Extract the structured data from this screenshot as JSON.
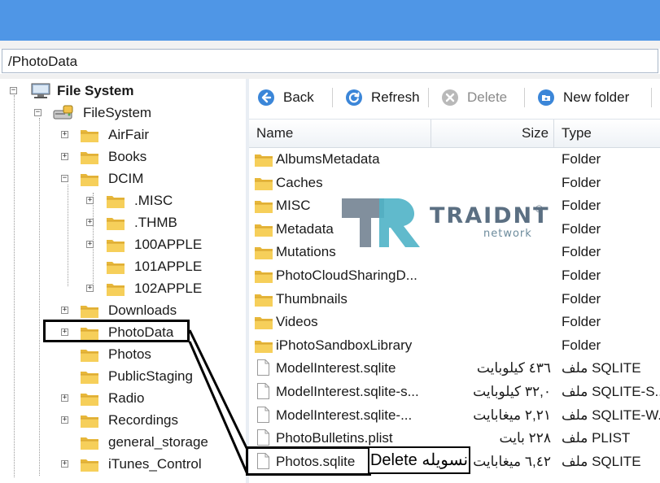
{
  "address": {
    "path": "/PhotoData"
  },
  "tree": {
    "items": [
      {
        "label": "File System",
        "bold": true
      },
      {
        "label": "FileSystem"
      },
      {
        "label": "AirFair"
      },
      {
        "label": "Books"
      },
      {
        "label": "DCIM"
      },
      {
        "label": ".MISC"
      },
      {
        "label": ".THMB"
      },
      {
        "label": "100APPLE"
      },
      {
        "label": "101APPLE"
      },
      {
        "label": "102APPLE"
      },
      {
        "label": "Downloads"
      },
      {
        "label": "PhotoData"
      },
      {
        "label": "Photos"
      },
      {
        "label": "PublicStaging"
      },
      {
        "label": "Radio"
      },
      {
        "label": "Recordings"
      },
      {
        "label": "general_storage"
      },
      {
        "label": "iTunes_Control"
      }
    ]
  },
  "toolbar": {
    "back": "Back",
    "refresh": "Refresh",
    "delete": "Delete",
    "new_folder": "New folder"
  },
  "columns": {
    "name": "Name",
    "size": "Size",
    "type": "Type"
  },
  "files": [
    {
      "name": "AlbumsMetadata",
      "size": "",
      "type": "Folder",
      "kind": "folder"
    },
    {
      "name": "Caches",
      "size": "",
      "type": "Folder",
      "kind": "folder"
    },
    {
      "name": "MISC",
      "size": "",
      "type": "Folder",
      "kind": "folder"
    },
    {
      "name": "Metadata",
      "size": "",
      "type": "Folder",
      "kind": "folder"
    },
    {
      "name": "Mutations",
      "size": "",
      "type": "Folder",
      "kind": "folder"
    },
    {
      "name": "PhotoCloudSharingD...",
      "size": "",
      "type": "Folder",
      "kind": "folder"
    },
    {
      "name": "Thumbnails",
      "size": "",
      "type": "Folder",
      "kind": "folder"
    },
    {
      "name": "Videos",
      "size": "",
      "type": "Folder",
      "kind": "folder"
    },
    {
      "name": "iPhotoSandboxLibrary",
      "size": "",
      "type": "Folder",
      "kind": "folder"
    },
    {
      "name": "ModelInterest.sqlite",
      "size": "٤٣٦ كيلوبايت",
      "type": "ملف SQLITE",
      "kind": "file"
    },
    {
      "name": "ModelInterest.sqlite-s...",
      "size": "٣٢,٠ كيلوبايت",
      "type": "ملف SQLITE-S...",
      "kind": "file"
    },
    {
      "name": "ModelInterest.sqlite-...",
      "size": "٢,٢١ ميغابايت",
      "type": "ملف SQLITE-W...",
      "kind": "file"
    },
    {
      "name": "PhotoBulletins.plist",
      "size": "٢٢٨ بايت",
      "type": "ملف PLIST",
      "kind": "file"
    },
    {
      "name": "Photos.sqlite",
      "size": "٦,٤٢ ميغابايت",
      "type": "ملف SQLITE",
      "kind": "file"
    }
  ],
  "watermark": {
    "brand": "TRAIDNT",
    "sub": "network",
    "reg": "®"
  },
  "annotation": {
    "label": "Delete نسويله"
  }
}
